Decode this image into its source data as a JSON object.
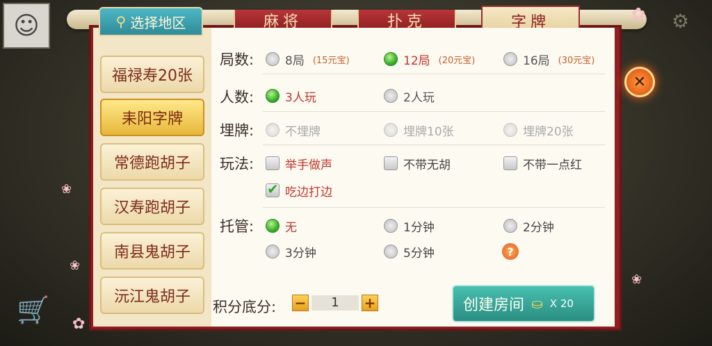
{
  "region_tab": {
    "label": "选择地区"
  },
  "top_tabs": [
    {
      "label": "麻将",
      "active": false
    },
    {
      "label": "扑克",
      "active": false
    },
    {
      "label": "字牌",
      "active": true
    }
  ],
  "sidebar": {
    "items": [
      {
        "label": "福禄寿20张",
        "active": false
      },
      {
        "label": "耒阳字牌",
        "active": true
      },
      {
        "label": "常德跑胡子",
        "active": false
      },
      {
        "label": "汉寿跑胡子",
        "active": false
      },
      {
        "label": "南县鬼胡子",
        "active": false
      },
      {
        "label": "沅江鬼胡子",
        "active": false
      }
    ]
  },
  "rounds": {
    "label": "局数:",
    "options": [
      {
        "text": "8局",
        "price": "(15元宝)",
        "selected": false
      },
      {
        "text": "12局",
        "price": "(20元宝)",
        "selected": true
      },
      {
        "text": "16局",
        "price": "(30元宝)",
        "selected": false
      }
    ]
  },
  "players": {
    "label": "人数:",
    "options": [
      {
        "text": "3人玩",
        "selected": true
      },
      {
        "text": "2人玩",
        "selected": false
      }
    ]
  },
  "bury": {
    "label": "埋牌:",
    "options": [
      {
        "text": "不埋牌",
        "disabled": true
      },
      {
        "text": "埋牌10张",
        "disabled": true
      },
      {
        "text": "埋牌20张",
        "disabled": true
      }
    ]
  },
  "rules": {
    "label": "玩法:",
    "options": [
      {
        "text": "举手做声",
        "checked": false,
        "highlight": true
      },
      {
        "text": "不带无胡",
        "checked": false
      },
      {
        "text": "不带一点红",
        "checked": false
      },
      {
        "text": "吃边打边",
        "checked": true,
        "highlight": true
      }
    ]
  },
  "trustee": {
    "label": "托管:",
    "options": [
      {
        "text": "无",
        "selected": true
      },
      {
        "text": "1分钟",
        "selected": false
      },
      {
        "text": "2分钟",
        "selected": false
      },
      {
        "text": "3分钟",
        "selected": false
      },
      {
        "text": "5分钟",
        "selected": false
      }
    ],
    "help_icon": "?"
  },
  "score_base": {
    "label": "积分底分:",
    "minus": "−",
    "value": "1",
    "plus": "+"
  },
  "create_button": {
    "label": "创建房间",
    "cost": "X 20"
  },
  "close_button": {
    "icon": "✕"
  },
  "colors": {
    "panel": "#8e1f22",
    "accent_green": "#39b02a",
    "selected_text": "#c0362c",
    "create_button": "#2a8e82"
  }
}
